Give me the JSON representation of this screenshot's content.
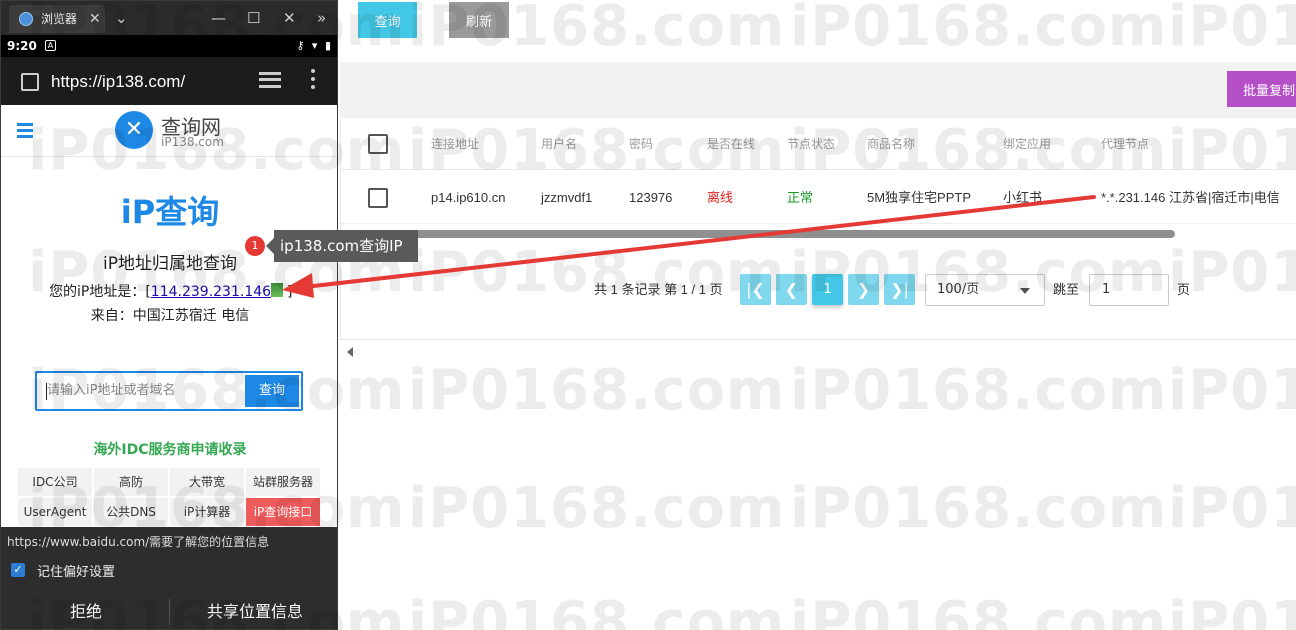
{
  "browser": {
    "tab_title": "浏览器",
    "tab_close": "✕",
    "chevron": "⌄",
    "window_controls": [
      "—",
      "☐",
      "✕"
    ],
    "overflow": "»"
  },
  "status_bar": {
    "time": "9:20",
    "a_icon": "A",
    "sys": "⚷ ▾ ▮"
  },
  "url_bar": {
    "url": "https://ip138.com/"
  },
  "site": {
    "logo_title": "查询网",
    "logo_sub": "iP138.com",
    "ip_title": "iP查询",
    "heading": "iP地址归属地查询",
    "ip_prefix": "您的iP地址是：[",
    "ip_value": "114.239.231.146",
    "ip_suffix": "]",
    "from": "来自：中国江苏宿迁 电信",
    "search_placeholder": "请输入iP地址或者域名",
    "search_button": "查询",
    "idc_title": "海外IDC服务商申请收录",
    "grid": [
      [
        "IDC公司",
        "高防",
        "大带宽",
        "站群服务器"
      ],
      [
        "UserAgent",
        "公共DNS",
        "iP计算器",
        "iP查询接口"
      ]
    ]
  },
  "permission": {
    "message": "https://www.baidu.com/需要了解您的位置信息",
    "remember": "记住偏好设置",
    "deny": "拒绝",
    "allow": "共享位置信息"
  },
  "annotation": {
    "badge": "1",
    "text": "ip138.com查询IP"
  },
  "toolbar": {
    "query": "查询",
    "refresh": "刷新",
    "batch_copy": "批量复制"
  },
  "table": {
    "headers": [
      "连接地址",
      "用户名",
      "密码",
      "是否在线",
      "节点状态",
      "商品名称",
      "绑定应用",
      "代理节点"
    ],
    "rows": [
      [
        "p14.ip610.cn",
        "jzzmvdf1",
        "123976",
        "离线",
        "正常",
        "5M独享住宅PPTP",
        "小红书",
        "*.*.231.146 江苏省|宿迁市|电信"
      ]
    ]
  },
  "pager": {
    "summary": "共 1 条记录 第 1 / 1 页",
    "first": "|❮",
    "prev": "❮",
    "current": "1",
    "next": "❯",
    "last": "❯|",
    "page_size": "100/页",
    "jump_label": "跳至",
    "jump_value": "1",
    "page_unit": "页"
  },
  "watermark": "iP0168.com",
  "colors": {
    "accent": "#42c8e6",
    "batch": "#b44fc7",
    "offline": "#e02020",
    "normal": "#1a9a2a",
    "site_blue": "#1e88e5",
    "arrow": "#e53935"
  },
  "icons": [
    "globe-icon",
    "chevron-down-icon",
    "minimize-icon",
    "maximize-icon",
    "close-icon",
    "key-icon",
    "wifi-icon",
    "battery-icon",
    "tabs-icon",
    "more-vert-icon",
    "hamburger-icon",
    "wrench-logo-icon",
    "flag-icon",
    "checkbox-icon",
    "arrow-annotation-icon"
  ]
}
